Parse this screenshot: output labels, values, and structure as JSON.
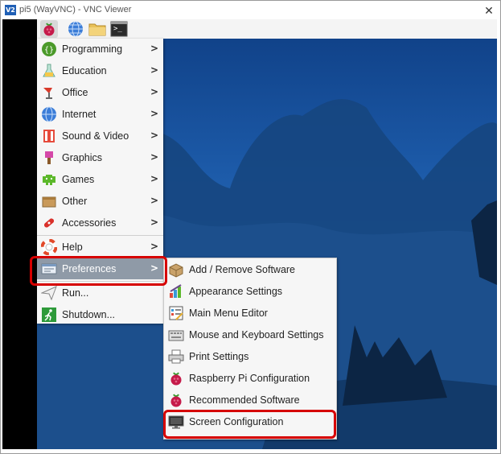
{
  "window": {
    "title": "pi5 (WayVNC) - VNC Viewer",
    "logo_text": "V2",
    "close_glyph": "✕"
  },
  "taskbar": {
    "buttons": [
      {
        "name": "raspberry-menu-icon"
      },
      {
        "name": "web-browser-icon"
      },
      {
        "name": "file-manager-icon"
      },
      {
        "name": "terminal-icon",
        "glyph": ">_"
      }
    ]
  },
  "main_menu": {
    "items": [
      {
        "label": "Programming",
        "icon": "programming-icon",
        "has_submenu": true
      },
      {
        "label": "Education",
        "icon": "education-icon",
        "has_submenu": true
      },
      {
        "label": "Office",
        "icon": "office-icon",
        "has_submenu": true
      },
      {
        "label": "Internet",
        "icon": "internet-icon",
        "has_submenu": true
      },
      {
        "label": "Sound & Video",
        "icon": "sound-video-icon",
        "has_submenu": true
      },
      {
        "label": "Graphics",
        "icon": "graphics-icon",
        "has_submenu": true
      },
      {
        "label": "Games",
        "icon": "games-icon",
        "has_submenu": true
      },
      {
        "label": "Other",
        "icon": "other-icon",
        "has_submenu": true
      },
      {
        "label": "Accessories",
        "icon": "accessories-icon",
        "has_submenu": true
      },
      {
        "label": "Help",
        "icon": "help-icon",
        "has_submenu": true
      },
      {
        "label": "Preferences",
        "icon": "preferences-icon",
        "has_submenu": true,
        "selected": true
      },
      {
        "label": "Run...",
        "icon": "run-icon",
        "has_submenu": false
      },
      {
        "label": "Shutdown...",
        "icon": "shutdown-icon",
        "has_submenu": false
      }
    ],
    "arrow_glyph": ">"
  },
  "preferences_submenu": {
    "items": [
      {
        "label": "Add / Remove Software",
        "icon": "package-icon"
      },
      {
        "label": "Appearance Settings",
        "icon": "appearance-icon"
      },
      {
        "label": "Main Menu Editor",
        "icon": "menu-editor-icon"
      },
      {
        "label": "Mouse and Keyboard Settings",
        "icon": "keyboard-icon"
      },
      {
        "label": "Print Settings",
        "icon": "printer-icon"
      },
      {
        "label": "Raspberry Pi Configuration",
        "icon": "raspberry-icon"
      },
      {
        "label": "Recommended Software",
        "icon": "raspberry-icon"
      },
      {
        "label": "Screen Configuration",
        "icon": "monitor-icon",
        "highlighted": true
      }
    ]
  },
  "colors": {
    "highlight_red": "#d60000",
    "selected_bg": "#8f9aa7",
    "menu_bg": "#f6f6f6",
    "raspberry": "#c51a4a"
  }
}
